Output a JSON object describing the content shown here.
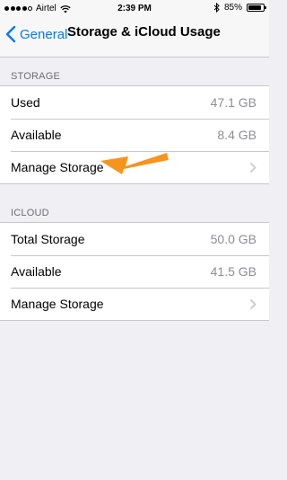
{
  "status_bar": {
    "carrier": "Airtel",
    "time": "2:39 PM",
    "battery_percent": "85%",
    "battery_level": 0.85,
    "signal_bars": 4,
    "signal_total": 5
  },
  "nav": {
    "back_label": "General",
    "title": "Storage & iCloud Usage"
  },
  "storage": {
    "header": "STORAGE",
    "rows": [
      {
        "label": "Used",
        "value": "47.1 GB"
      },
      {
        "label": "Available",
        "value": "8.4 GB"
      },
      {
        "label": "Manage Storage"
      }
    ]
  },
  "icloud": {
    "header": "ICLOUD",
    "rows": [
      {
        "label": "Total Storage",
        "value": "50.0 GB"
      },
      {
        "label": "Available",
        "value": "41.5 GB"
      },
      {
        "label": "Manage Storage"
      }
    ]
  },
  "colors": {
    "accent": "#007aff",
    "annotation_arrow": "#f7941d",
    "background": "#efeff4"
  },
  "icons": [
    "back-chevron-icon",
    "wifi-icon",
    "bluetooth-icon",
    "battery-icon",
    "chevron-right-icon"
  ]
}
